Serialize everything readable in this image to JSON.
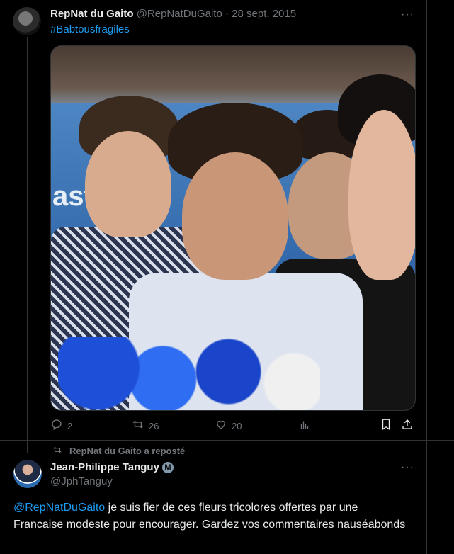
{
  "tweet1": {
    "display_name": "RepNat du Gaito",
    "handle": "@RepNatDuGaito",
    "separator": " · ",
    "date": "28 sept. 2015",
    "hashtag": "#Babtousfragiles",
    "photo_banner_text": "ast",
    "more": "···",
    "actions": {
      "replies": "2",
      "retweets": "26",
      "likes": "20"
    }
  },
  "tweet2": {
    "reposted_by": "RepNat du Gaito a reposté",
    "display_name": "Jean-Philippe Tanguy",
    "verified_mark": "M",
    "handle": "@JphTanguy",
    "more": "···",
    "mention": "@RepNatDuGaito",
    "text": " je suis fier de ces fleurs tricolores offertes par une Francaise modeste pour encourager. Gardez vos commentaires nauséabonds"
  },
  "icons": {
    "reply": "reply-icon",
    "retweet": "retweet-icon",
    "like": "heart-icon",
    "views": "views-icon",
    "bookmark": "bookmark-icon",
    "share": "share-icon"
  },
  "colors": {
    "background": "#000000",
    "text": "#e7e9ea",
    "muted": "#71767b",
    "accent": "#1d9bf0"
  }
}
